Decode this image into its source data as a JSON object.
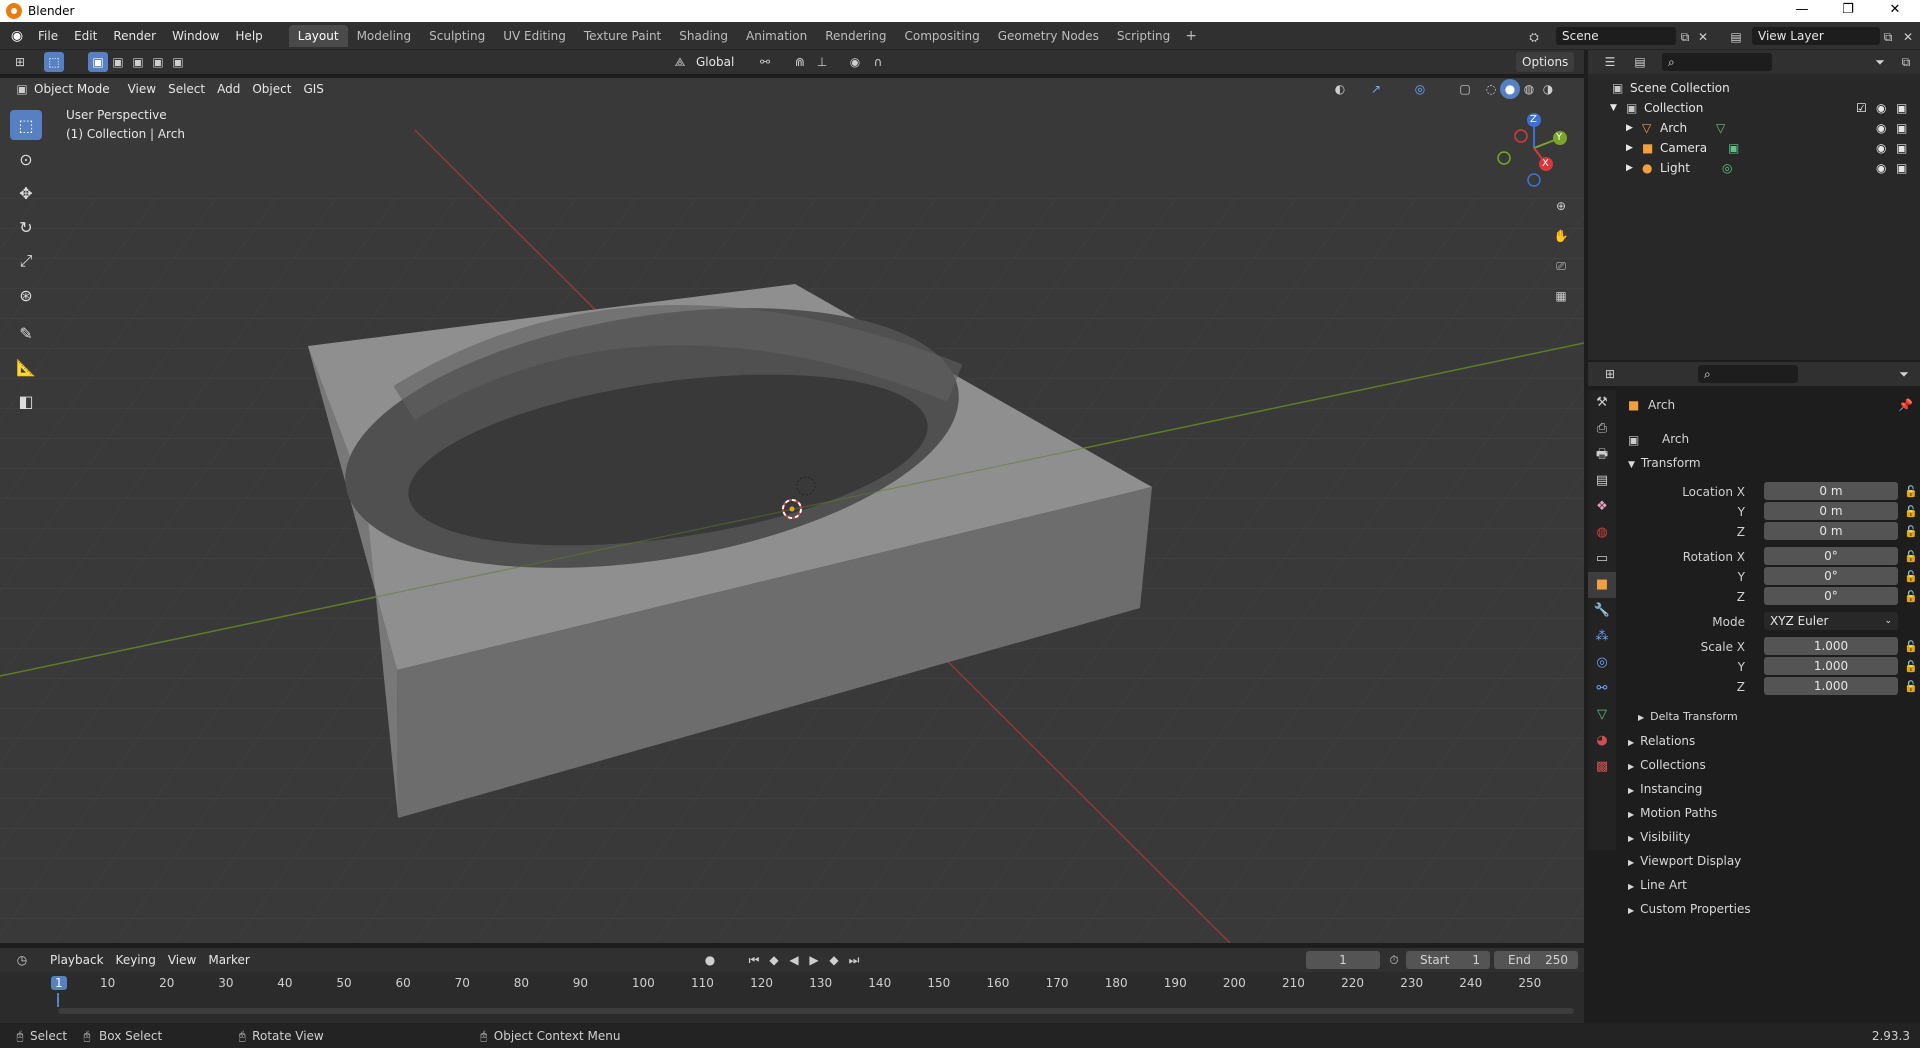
{
  "window": {
    "title": "Blender"
  },
  "menu": [
    "File",
    "Edit",
    "Render",
    "Window",
    "Help"
  ],
  "workspaces": [
    "Layout",
    "Modeling",
    "Sculpting",
    "UV Editing",
    "Texture Paint",
    "Shading",
    "Animation",
    "Rendering",
    "Compositing",
    "Geometry Nodes",
    "Scripting"
  ],
  "active_workspace": "Layout",
  "scene": {
    "name": "Scene",
    "view_layer": "View Layer"
  },
  "viewport": {
    "mode": "Object Mode",
    "menus": [
      "View",
      "Select",
      "Add",
      "Object",
      "GIS"
    ],
    "transform_orientation": "Global",
    "options_label": "Options",
    "overlay_line1": "User Perspective",
    "overlay_line2": "(1) Collection | Arch",
    "gizmo": {
      "x": "X",
      "y": "Y",
      "z": "Z"
    }
  },
  "outliner": {
    "root": "Scene Collection",
    "collection": "Collection",
    "items": [
      "Arch",
      "Camera",
      "Light"
    ]
  },
  "properties": {
    "object_name": "Arch",
    "data_name": "Arch",
    "transform_title": "Transform",
    "location": {
      "label_x": "Location X",
      "label_y": "Y",
      "label_z": "Z",
      "x": "0 m",
      "y": "0 m",
      "z": "0 m"
    },
    "rotation": {
      "label_x": "Rotation X",
      "label_y": "Y",
      "label_z": "Z",
      "x": "0°",
      "y": "0°",
      "z": "0°"
    },
    "mode_label": "Mode",
    "mode_value": "XYZ Euler",
    "scale": {
      "label_x": "Scale X",
      "label_y": "Y",
      "label_z": "Z",
      "x": "1.000",
      "y": "1.000",
      "z": "1.000"
    },
    "delta": "Delta Transform",
    "panels": [
      "Relations",
      "Collections",
      "Instancing",
      "Motion Paths",
      "Visibility",
      "Viewport Display",
      "Line Art",
      "Custom Properties"
    ]
  },
  "timeline": {
    "menus": [
      "Playback",
      "Keying",
      "View",
      "Marker"
    ],
    "current_frame": "1",
    "start_label": "Start",
    "start": "1",
    "end_label": "End",
    "end": "250",
    "ticks": [
      "1",
      "10",
      "20",
      "30",
      "40",
      "50",
      "60",
      "70",
      "80",
      "90",
      "100",
      "110",
      "120",
      "130",
      "140",
      "150",
      "160",
      "170",
      "180",
      "190",
      "200",
      "210",
      "220",
      "230",
      "240",
      "250"
    ]
  },
  "status": {
    "select": "Select",
    "box_select": "Box Select",
    "rotate_view": "Rotate View",
    "context_menu": "Object Context Menu",
    "version": "2.93.3"
  }
}
